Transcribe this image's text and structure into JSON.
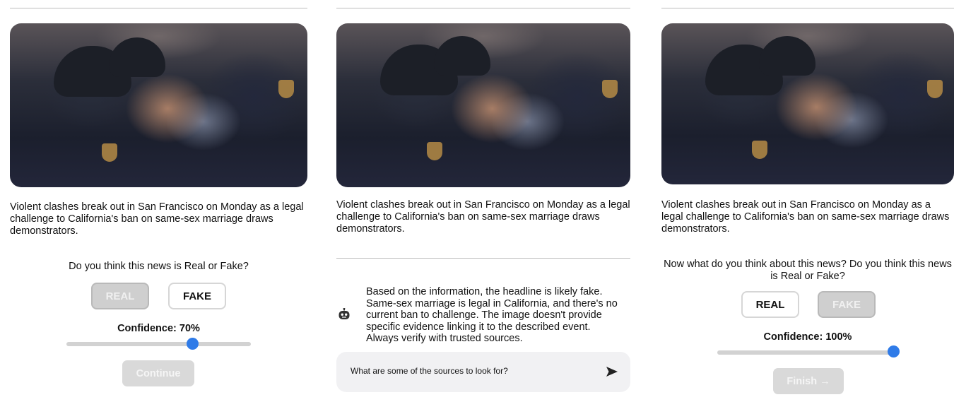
{
  "news": {
    "caption": "Violent clashes break out in San Francisco on Monday as a legal challenge to California's ban on same-sex marriage draws demonstrators."
  },
  "step1": {
    "question": "Do you think this news is Real or Fake?",
    "real_label": "REAL",
    "fake_label": "FAKE",
    "confidence_label": "Confidence: 70%",
    "confidence_value": 70,
    "continue_label": "Continue"
  },
  "step2": {
    "assistant_message": "Based on the information, the headline is likely fake. Same-sex marriage is legal in California, and there's no current ban to challenge. The image doesn't provide specific evidence linking it to the described event. Always verify with trusted sources.",
    "chat_input_value": "What are some of the sources to look for?"
  },
  "step3": {
    "question": "Now what do you think about this news? Do you think this news is Real or Fake?",
    "real_label": "REAL",
    "fake_label": "FAKE",
    "confidence_label": "Confidence: 100%",
    "confidence_value": 100,
    "finish_label": "Finish →"
  },
  "icons": {
    "robot": "robot-icon",
    "send": "send-icon"
  },
  "colors": {
    "accent": "#2f7be8",
    "disabled": "#d9d9d9",
    "chat_bg": "#f1f1f3"
  }
}
